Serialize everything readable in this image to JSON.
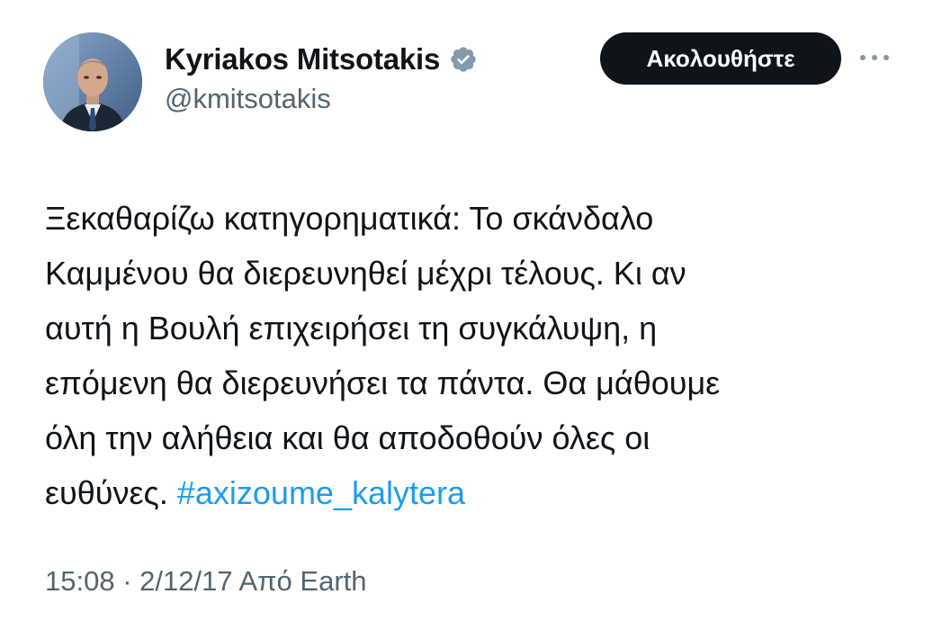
{
  "author": {
    "display_name": "Kyriakos Mitsotakis",
    "handle": "@kmitsotakis",
    "verified": true,
    "avatar_icon": "profile-photo"
  },
  "actions": {
    "follow_label": "Ακολουθήστε",
    "more_icon": "ellipsis-icon"
  },
  "tweet": {
    "lines": [
      "Ξεκαθαρίζω κατηγορηματικά: Το σκάνδαλο",
      "Καμμένου θα διερευνηθεί μέχρι τέλους. Κι αν",
      "αυτή η Βουλή επιχειρήσει τη συγκάλυψη, η",
      "επόμενη θα διερευνήσει τα πάντα. Θα μάθουμε",
      "όλη την αλήθεια και θα αποδοθούν όλες οι"
    ],
    "last_line_text": "ευθύνες. ",
    "hashtag": "#axizoume_kalytera"
  },
  "meta": {
    "time": "15:08",
    "separator": " · ",
    "date": "2/12/17",
    "source": " Από Earth"
  },
  "colors": {
    "text": "#0f1419",
    "secondary": "#536471",
    "link": "#1d9bf0",
    "verified_badge": "#829aab",
    "follow_bg": "#0f1419"
  }
}
